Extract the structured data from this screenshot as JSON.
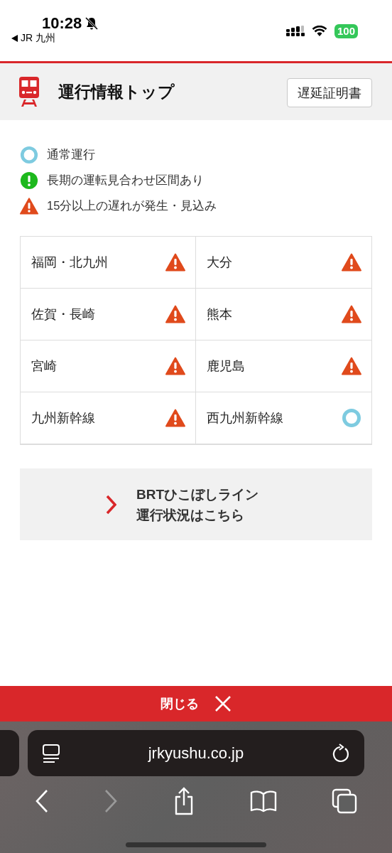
{
  "status_bar": {
    "time": "10:28",
    "back_app": "JR 九州",
    "battery": "100"
  },
  "header": {
    "title": "運行情報トップ",
    "button": "遅延証明書"
  },
  "legend": [
    {
      "kind": "normal",
      "label": "通常運行"
    },
    {
      "kind": "suspended",
      "label": "長期の運転見合わせ区間あり"
    },
    {
      "kind": "delay",
      "label": "15分以上の遅れが発生・見込み"
    }
  ],
  "regions": [
    {
      "name": "福岡・北九州",
      "kind": "delay"
    },
    {
      "name": "大分",
      "kind": "delay"
    },
    {
      "name": "佐賀・長崎",
      "kind": "delay"
    },
    {
      "name": "熊本",
      "kind": "delay"
    },
    {
      "name": "宮崎",
      "kind": "delay"
    },
    {
      "name": "鹿児島",
      "kind": "delay"
    },
    {
      "name": "九州新幹線",
      "kind": "delay"
    },
    {
      "name": "西九州新幹線",
      "kind": "normal"
    }
  ],
  "brt_link": {
    "lines": [
      "BRTひこぼしライン",
      "運行状況はこちら"
    ]
  },
  "close_bar": {
    "label": "閉じる"
  },
  "browser": {
    "url": "jrkyushu.co.jp",
    "back_enabled": true,
    "forward_enabled": false
  }
}
